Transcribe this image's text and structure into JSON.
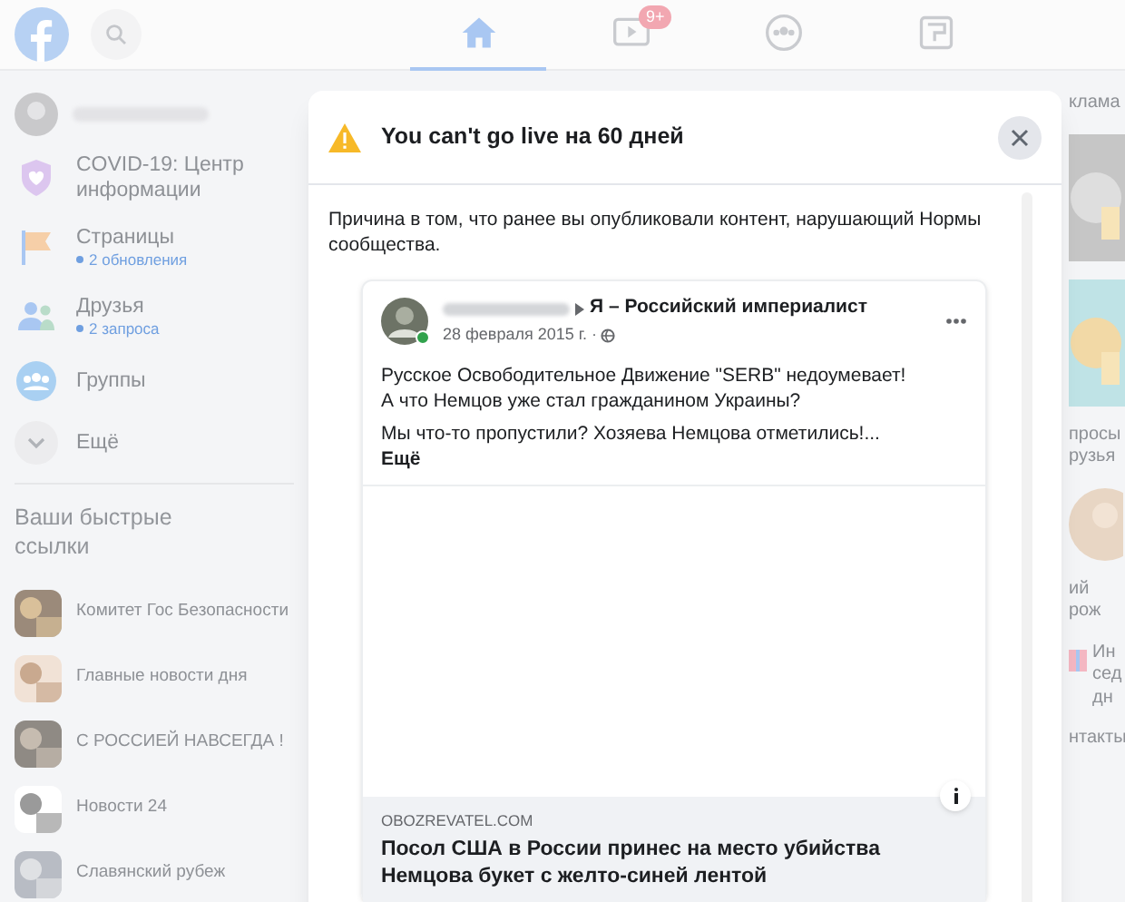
{
  "header": {
    "tabs": [
      {
        "kind": "home",
        "selected": true
      },
      {
        "kind": "video",
        "selected": false,
        "badge": "9+"
      },
      {
        "kind": "groups",
        "selected": false
      },
      {
        "kind": "gaming",
        "selected": false
      }
    ]
  },
  "sidebar": {
    "items": [
      {
        "kind": "profile"
      },
      {
        "kind": "covid",
        "label": "COVID-19: Центр информации"
      },
      {
        "kind": "pages",
        "label": "Страницы",
        "sublabel": "2 обновления"
      },
      {
        "kind": "friends",
        "label": "Друзья",
        "sublabel": "2 запроса"
      },
      {
        "kind": "groups",
        "label": "Группы"
      },
      {
        "kind": "more",
        "label": "Ещё"
      }
    ],
    "shortcuts_title": "Ваши быстрые ссылки",
    "shortcuts": [
      {
        "label": "Комитет Гос Безопасности"
      },
      {
        "label": "Главные новости дня"
      },
      {
        "label": "С РОССИЕЙ НАВСЕГДА !"
      },
      {
        "label": "Новости 24"
      },
      {
        "label": "Славянский рубеж"
      }
    ]
  },
  "right_column": [
    {
      "kind": "heading",
      "text": "клама"
    },
    {
      "kind": "picture"
    },
    {
      "kind": "picture"
    },
    {
      "kind": "heading",
      "text": "просы рузья"
    },
    {
      "kind": "avatar"
    },
    {
      "kind": "heading",
      "text": "ий рож"
    },
    {
      "kind": "birthday",
      "text": "Ин сед дн"
    },
    {
      "kind": "heading",
      "text": "нтакты"
    }
  ],
  "modal": {
    "title": "You can't go live на 60 дней",
    "reason": "Причина в том, что ранее вы опубликовали контент, нарушающий Нормы сообщества.",
    "post": {
      "group": "Я – Российский империалист",
      "date": "28 февраля 2015 г. ·",
      "online": true,
      "paragraphs": [
        "Русское Освободительное Движение \"SERB\" недоумевает! А что Немцов уже стал гражданином Украины?",
        "Мы что-то пропустили? Хозяева Немцова отметились!..."
      ],
      "more": "Ещё",
      "link": {
        "domain": "OBOZREVATEL.COM",
        "title": "Посол США в России принес на место убийства Немцова букет с желто-синей лентой"
      }
    }
  }
}
